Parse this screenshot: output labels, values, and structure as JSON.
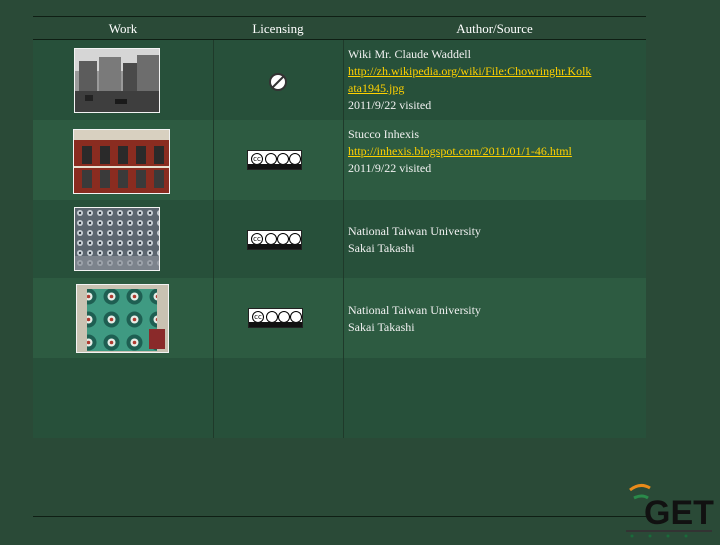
{
  "headers": {
    "work": "Work",
    "licensing": "Licensing",
    "author": "Author/Source"
  },
  "rows": [
    {
      "line1": "Wiki Mr. Claude Waddell",
      "link": "http://zh.wikipedia.org/wiki/File:Chowringhr.Kolk ata1945.jpg",
      "visited": "2011/9/22 visited",
      "license_icon": "public-domain-icon"
    },
    {
      "line1": "Stucco Inhexis",
      "link": "http://inhexis.blogspot.com/2011/01/1-46.html",
      "visited": "2011/9/22 visited",
      "license_icon": "cc-by-nc-nd-icon"
    },
    {
      "line1": "National Taiwan University",
      "line2": "Sakai Takashi",
      "license_icon": "cc-by-nc-sa-icon"
    },
    {
      "line1": "National Taiwan University",
      "line2": "Sakai Takashi",
      "license_icon": "cc-by-nc-sa-icon"
    }
  ],
  "logo": {
    "text": "GET",
    "icon": "get-logo-icon"
  }
}
